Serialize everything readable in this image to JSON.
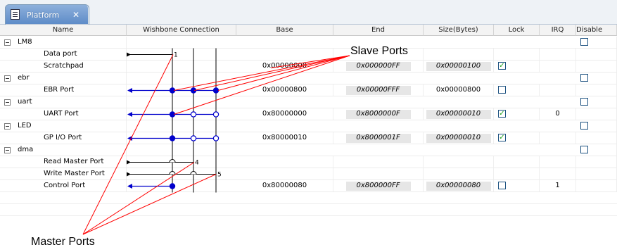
{
  "tab": {
    "title": "Platform",
    "close": "✕",
    "icon": "document-icon"
  },
  "columns": [
    "Name",
    "Wishbone Connection",
    "Base",
    "End",
    "Size(Bytes)",
    "Lock",
    "IRQ",
    "Disable"
  ],
  "groups": [
    {
      "name": "LM8",
      "disable": false,
      "ports": [
        {
          "name": "Data port",
          "base": "",
          "end": "",
          "size": "",
          "lock": null,
          "irq": ""
        },
        {
          "name": "Scratchpad",
          "base": "0x00000000",
          "end": "0x000000FF",
          "size": "0x00000100",
          "lock": true,
          "irq": ""
        }
      ]
    },
    {
      "name": "ebr",
      "disable": false,
      "ports": [
        {
          "name": "EBR Port",
          "base": "0x00000800",
          "end": "0x00000FFF",
          "size": "0x00000800",
          "lock": false,
          "irq": ""
        }
      ]
    },
    {
      "name": "uart",
      "disable": false,
      "ports": [
        {
          "name": "UART Port",
          "base": "0x80000000",
          "end": "0x8000000F",
          "size": "0x00000010",
          "lock": true,
          "irq": "0"
        }
      ]
    },
    {
      "name": "LED",
      "disable": false,
      "ports": [
        {
          "name": "GP I/O Port",
          "base": "0x80000010",
          "end": "0x8000001F",
          "size": "0x00000010",
          "lock": true,
          "irq": ""
        }
      ]
    },
    {
      "name": "dma",
      "disable": false,
      "ports": [
        {
          "name": "Read Master Port",
          "base": "",
          "end": "",
          "size": "",
          "lock": null,
          "irq": ""
        },
        {
          "name": "Write Master Port",
          "base": "",
          "end": "",
          "size": "",
          "lock": null,
          "irq": ""
        },
        {
          "name": "Control Port",
          "base": "0x80000080",
          "end": "0x800000FF",
          "size": "0x00000080",
          "lock": false,
          "irq": "1"
        }
      ]
    }
  ],
  "wire_labels": [
    "1",
    "4",
    "5"
  ],
  "annotations": {
    "slave": "Slave Ports",
    "master": "Master Ports"
  },
  "colors": {
    "wire": "#0000cc",
    "annotation": "#ff0000"
  }
}
